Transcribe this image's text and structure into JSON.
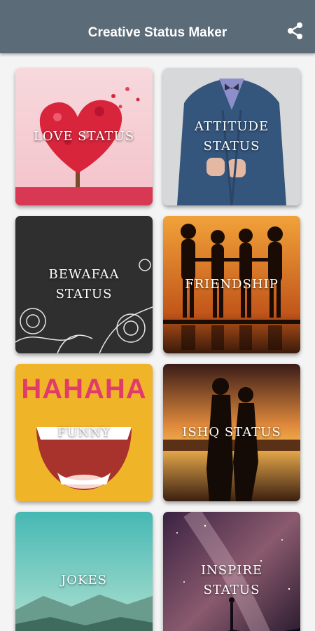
{
  "header": {
    "title": "Creative Status Maker",
    "share_icon": "share-icon"
  },
  "colors": {
    "appbar": "#5b6b78",
    "background": "#f4f4f4"
  },
  "categories": [
    {
      "label": "LOVE STATUS"
    },
    {
      "label": "ATTITUDE\nSTATUS"
    },
    {
      "label": "BEWAFAA\nSTATUS"
    },
    {
      "label": "FRIENDSHIP"
    },
    {
      "label": "FUNNY",
      "art_text": "HAHAHA"
    },
    {
      "label": "ISHQ STATUS"
    },
    {
      "label": "JOKES"
    },
    {
      "label": "INSPIRE\nSTATUS"
    }
  ]
}
